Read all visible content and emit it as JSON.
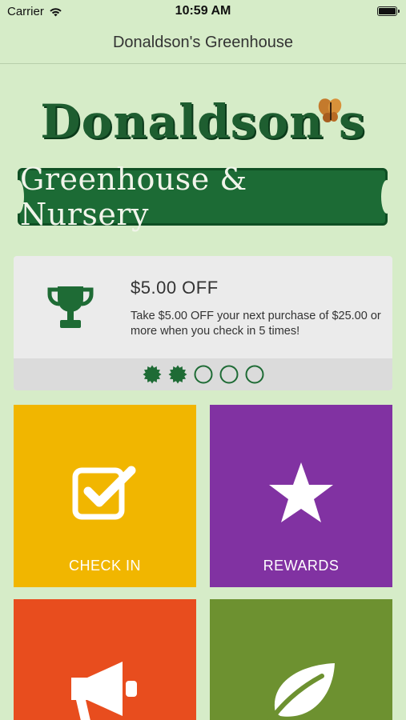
{
  "status_bar": {
    "carrier": "Carrier",
    "time": "10:59 AM",
    "icons": [
      "wifi-icon",
      "battery-icon"
    ]
  },
  "nav": {
    "title": "Donaldson's Greenhouse"
  },
  "logo": {
    "line1": "Donaldson's",
    "line2": "Greenhouse & Nursery",
    "colors": {
      "green": "#1c6b35",
      "dark_green": "#0f4f24"
    }
  },
  "reward": {
    "icon": "trophy-icon",
    "title": "$5.00 OFF",
    "description": "Take $5.00 OFF your next purchase of $25.00 or more when you check in 5 times!",
    "checkins_completed": 2,
    "checkins_required": 5
  },
  "tiles": {
    "check_in": {
      "label": "CHECK IN",
      "icon": "checkbox-icon",
      "color": "#f1b600"
    },
    "rewards": {
      "label": "REWARDS",
      "icon": "star-icon",
      "color": "#8132a2"
    },
    "news": {
      "label": "",
      "icon": "megaphone-icon",
      "color": "#e84d1e"
    },
    "about": {
      "label": "",
      "icon": "leaf-icon",
      "color": "#6d9130"
    }
  },
  "colors": {
    "background": "#d6ecc8",
    "accent_green": "#1e5e30"
  }
}
